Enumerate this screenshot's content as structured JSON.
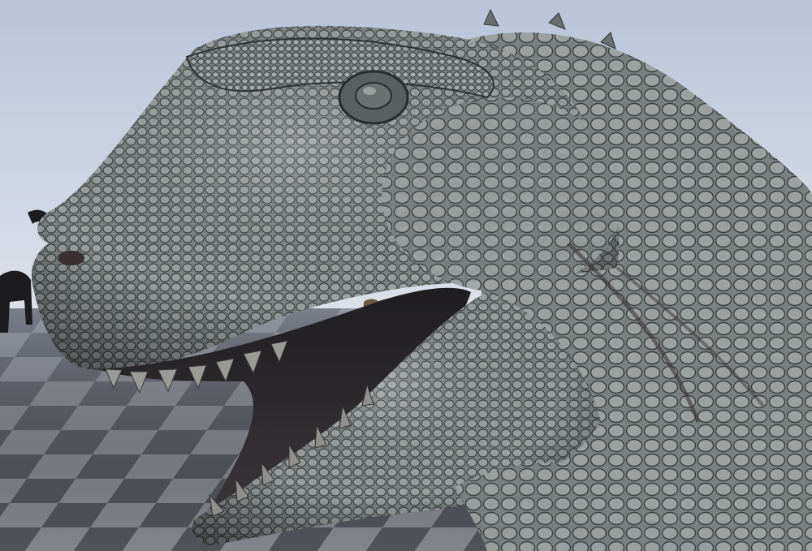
{
  "scene": {
    "subject": "dinosaur-head-model",
    "colors": {
      "sky_top": "#b9c4d9",
      "sky_bottom": "#dfe3ea",
      "floor_dark": "#4e5058",
      "floor_light": "#8a8c93",
      "skin_base": "#8a8f8f",
      "skin_shadow": "#3f4446",
      "skin_highlight": "#c9ccca",
      "mouth_dark": "#2b2a2c",
      "teeth": "#9a9a96"
    }
  }
}
